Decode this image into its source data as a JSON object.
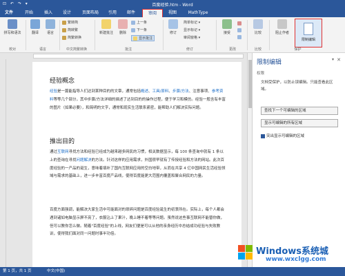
{
  "window": {
    "title": "百度经验.htm - Word",
    "qat": "⊡ ↶ ↷ ▾"
  },
  "tabs": [
    {
      "label": "文件"
    },
    {
      "label": "开始"
    },
    {
      "label": "插入"
    },
    {
      "label": "设计"
    },
    {
      "label": "页面布局"
    },
    {
      "label": "引用"
    },
    {
      "label": "邮件"
    },
    {
      "label": "审阅"
    },
    {
      "label": "视图"
    },
    {
      "label": "MathType"
    }
  ],
  "ribbon": {
    "proofing": {
      "spell": "拼写和语法",
      "label": "校对"
    },
    "language": {
      "translate": "翻译",
      "language": "语言",
      "label": "语言"
    },
    "chinese": {
      "t2s": "繁转简",
      "s2t": "简转繁",
      "convert": "简繁转换",
      "label": "中文简繁转换"
    },
    "comments": {
      "new": "新建批注",
      "delete": "删除",
      "prev": "上一条",
      "next": "下一条",
      "show": "显示批注",
      "label": "批注"
    },
    "tracking": {
      "track": "修订",
      "simple": "简单标记",
      "markup": "显示标记",
      "pane": "审阅窗格",
      "label": "修订"
    },
    "changes": {
      "accept": "接受",
      "label": "更改"
    },
    "compare": {
      "compare": "比较",
      "label": "比较"
    },
    "protect": {
      "block": "阻止作者",
      "restrict": "限制编辑",
      "label": "保护"
    }
  },
  "document": {
    "h1": "经验概念",
    "p1_a": "经验",
    "p1_b": "是一篇能指导人们达到某种目的的文章，通常包括",
    "p1_c": "概述",
    "p1_d": "、",
    "p1_e": "工具/原料",
    "p1_f": "、",
    "p1_g": "步骤/方法",
    "p1_h": "、注意事项、",
    "p1_i": "参考资料",
    "p1_j": "等等几个部分，其中步骤/方法详细的描述了达到目的的操作过程，便于学习和模仿。经验一般含有丰富的图片（如果必要），和简明的文字，通常和现实生活联系紧密，能帮助人们解决实际问题。",
    "h2": "推出目的",
    "p2_a": "通过",
    "p2_b": "互联网",
    "p2_c": "寻找方法和经验已经成为越来越多网民的习惯，相关数据显示，每 100 条查询中就有 1 条以上的查询在寻找",
    "p2_d": "问题解决",
    "p2_e": "的方法。针对这样的应用需求，外国很早就有了传授经验和方法的网站。此次百度经验的一产品的诞生，意味着填补了国内互联网应用的空白地带，从而在共享 4 亿中国网民生活经验领域与需求的基础上，进一步丰富百度产品线，使得百度能更大范围内覆盖和聚合网民的力量。",
    "p3": "百度方面强调，能解决大家生活中可能面对的琐碎问题是百度经验诞生的初衷所在。实际上，每个人都会遇到诸如电脑显示屏不亮了，衣服沾上了果汁，晚上睡不着等等问题。虽然说这些事互联网不能替你做，但可以教你怎么做。随着\"百度经验\"的上线，网友们便是可以从他的亲身经历中总结成功经验与失败教训，使得我们面对同一问题时事半功倍。"
  },
  "pane": {
    "title": "限制编辑",
    "pin": "▾",
    "close": "✕",
    "section": "权限",
    "desc": "文档受保护，以防止误编辑。只能查看此区域。",
    "btn1": "查找下一个可编辑的区域",
    "btn2": "显示可编辑的所有区域",
    "check": "突出显示可编辑的区域"
  },
  "status": {
    "page": "第 1 页，共 1 页",
    "lang": "中文(中国)"
  },
  "watermark": {
    "main": "Windows系统城",
    "sub": "www.wxclgg.com"
  },
  "colors": {
    "brand": "#2b579a",
    "link": "#1e6fc8",
    "highlight": "#e03030"
  }
}
